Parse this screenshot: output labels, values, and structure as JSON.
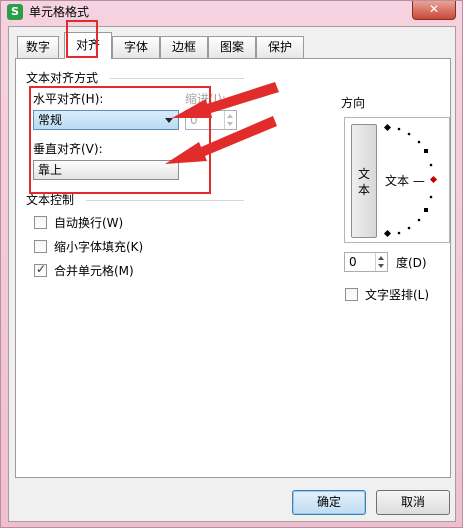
{
  "window": {
    "title": "单元格格式",
    "app_icon_letter": "S",
    "close_symbol": "✕"
  },
  "tabs": [
    {
      "label": "数字"
    },
    {
      "label": "对齐"
    },
    {
      "label": "字体"
    },
    {
      "label": "边框"
    },
    {
      "label": "图案"
    },
    {
      "label": "保护"
    }
  ],
  "active_tab": "对齐",
  "text_alignment": {
    "group_title": "文本对齐方式",
    "horizontal": {
      "label": "水平对齐(H):",
      "value": "常规"
    },
    "vertical": {
      "label": "垂直对齐(V):",
      "value": "靠上"
    },
    "indent": {
      "label": "缩进(I):",
      "value": "0"
    }
  },
  "text_control": {
    "group_title": "文本控制",
    "wrap_text": {
      "label": "自动换行(W)",
      "checked": false
    },
    "shrink_to_fit": {
      "label": "缩小字体填充(K)",
      "checked": false
    },
    "merge_cells": {
      "label": "合并单元格(M)",
      "checked": true
    }
  },
  "orientation": {
    "group_title": "方向",
    "vertical_text_char_1": "文",
    "vertical_text_char_2": "本",
    "dial_text": "文本 —",
    "degrees_value": "0",
    "degrees_label": "度(D)",
    "vertical_text_checkbox": {
      "label": "文字竖排(L)",
      "checked": false
    }
  },
  "buttons": {
    "ok": "确定",
    "cancel": "取消"
  },
  "colors": {
    "annotation_red": "#e22b2b",
    "dial_marker": "#c00000"
  }
}
